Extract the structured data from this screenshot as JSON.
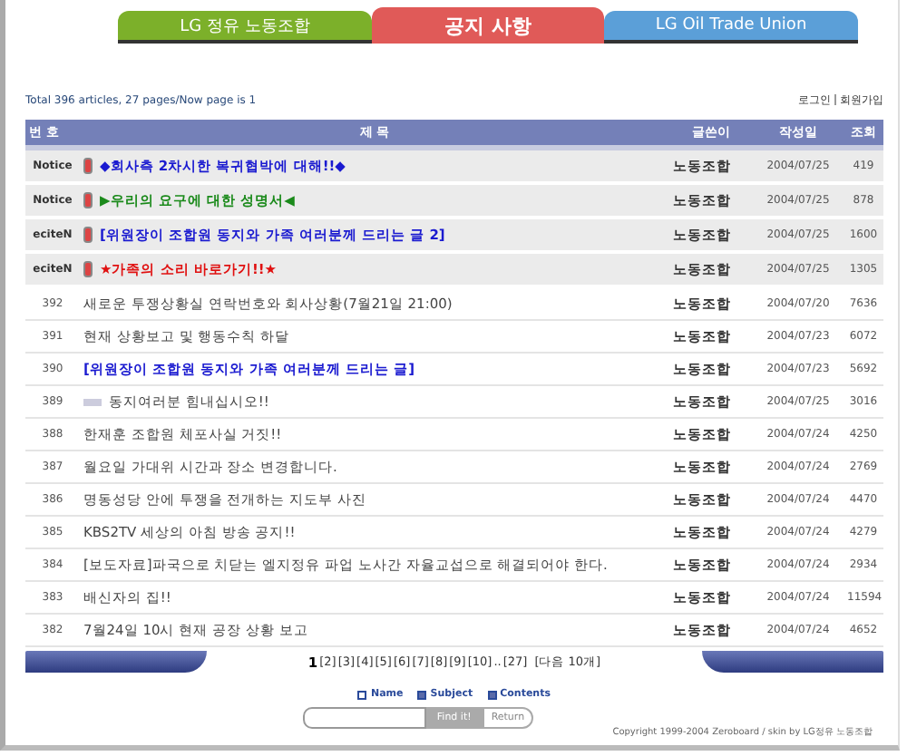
{
  "header_tabs": [
    {
      "label": "LG 정유 노동조합",
      "selected": false
    },
    {
      "label": "공지 사항",
      "selected": true
    },
    {
      "label": "LG Oil Trade Union",
      "selected": false
    }
  ],
  "summary": {
    "total_label": "Total",
    "total": "396",
    "articles_label": "articles,",
    "pages": "27",
    "pages_label": "pages/Now page is",
    "current_page": "1"
  },
  "account_links": [
    "로그인",
    "회원가입"
  ],
  "table": {
    "columns": [
      "번 호",
      "제 목",
      "글쓴이",
      "작성일",
      "조회"
    ],
    "rows": [
      {
        "number": "Notice",
        "notice": true,
        "new": false,
        "title": "◆회사측 2차시한 복귀협박에 대해!!◆",
        "color": "#1a1ad0",
        "emphasis": true,
        "writer": "노동조합",
        "date": "2004/07/25",
        "views": "419"
      },
      {
        "number": "Notice",
        "notice": true,
        "new": false,
        "title": "▶우리의 요구에 대한 성명서◀",
        "color": "#1b8a1b",
        "emphasis": true,
        "writer": "노동조합",
        "date": "2004/07/25",
        "views": "878"
      },
      {
        "number": "eciteN",
        "notice": true,
        "new": false,
        "title": "[위원장이 조합원 동지와 가족 여러분께 드리는 글 2]",
        "color": "#1a1ad0",
        "emphasis": true,
        "writer": "노동조합",
        "date": "2004/07/25",
        "views": "1600"
      },
      {
        "number": "eciteN",
        "notice": true,
        "new": false,
        "title": "★가족의 소리 바로가기!!★",
        "color": "#e01010",
        "emphasis": true,
        "writer": "노동조합",
        "date": "2004/07/25",
        "views": "1305"
      },
      {
        "number": "392",
        "notice": false,
        "new": false,
        "title": "새로운 투쟁상황실 연락번호와 회사상황(7월21일 21:00)",
        "color": "#444444",
        "emphasis": false,
        "writer": "노동조합",
        "date": "2004/07/20",
        "views": "7636"
      },
      {
        "number": "391",
        "notice": false,
        "new": false,
        "title": "현재 상황보고 및 행동수칙 하달",
        "color": "#444444",
        "emphasis": false,
        "writer": "노동조합",
        "date": "2004/07/23",
        "views": "6072"
      },
      {
        "number": "390",
        "notice": false,
        "new": false,
        "title": "[위원장이 조합원 동지와 가족 여러분께 드리는 글]",
        "color": "#1a1ad0",
        "emphasis": true,
        "writer": "노동조합",
        "date": "2004/07/23",
        "views": "5692"
      },
      {
        "number": "389",
        "notice": false,
        "new": true,
        "title": "동지여러분 힘내십시오!!",
        "color": "#444444",
        "emphasis": false,
        "writer": "노동조합",
        "date": "2004/07/25",
        "views": "3016"
      },
      {
        "number": "388",
        "notice": false,
        "new": false,
        "title": "한재훈 조합원 체포사실 거짓!!",
        "color": "#444444",
        "emphasis": false,
        "writer": "노동조합",
        "date": "2004/07/24",
        "views": "4250"
      },
      {
        "number": "387",
        "notice": false,
        "new": false,
        "title": "월요일 가대위 시간과 장소 변경합니다.",
        "color": "#444444",
        "emphasis": false,
        "writer": "노동조합",
        "date": "2004/07/24",
        "views": "2769"
      },
      {
        "number": "386",
        "notice": false,
        "new": false,
        "title": "명동성당 안에 투쟁을 전개하는 지도부 사진",
        "color": "#444444",
        "emphasis": false,
        "writer": "노동조합",
        "date": "2004/07/24",
        "views": "4470"
      },
      {
        "number": "385",
        "notice": false,
        "new": false,
        "title": "KBS2TV 세상의 아침 방송 공지!!",
        "color": "#444444",
        "emphasis": false,
        "writer": "노동조합",
        "date": "2004/07/24",
        "views": "4279"
      },
      {
        "number": "384",
        "notice": false,
        "new": false,
        "title": "[보도자료]파국으로 치닫는 엘지정유 파업 노사간 자율교섭으로 해결되어야 한다.",
        "color": "#444444",
        "emphasis": false,
        "writer": "노동조합",
        "date": "2004/07/24",
        "views": "2934"
      },
      {
        "number": "383",
        "notice": false,
        "new": false,
        "title": "배신자의 집!!",
        "color": "#444444",
        "emphasis": false,
        "writer": "노동조합",
        "date": "2004/07/24",
        "views": "11594"
      },
      {
        "number": "382",
        "notice": false,
        "new": false,
        "title": "7월24일 10시 현재 공장 상황 보고",
        "color": "#444444",
        "emphasis": false,
        "writer": "노동조합",
        "date": "2004/07/24",
        "views": "4652"
      }
    ]
  },
  "pagination": {
    "pages": [
      {
        "label": "1",
        "selected": true
      },
      {
        "label": "[2]",
        "selected": false
      },
      {
        "label": "[3]",
        "selected": false
      },
      {
        "label": "[4]",
        "selected": false
      },
      {
        "label": "[5]",
        "selected": false
      },
      {
        "label": "[6]",
        "selected": false
      },
      {
        "label": "[7]",
        "selected": false
      },
      {
        "label": "[8]",
        "selected": false
      },
      {
        "label": "[9]",
        "selected": false
      },
      {
        "label": "[10]",
        "selected": false
      }
    ],
    "ellipsis": "..",
    "last": "[27]",
    "next": "[다음 10개]"
  },
  "search": {
    "options": [
      {
        "label": "Name",
        "checked": false
      },
      {
        "label": "Subject",
        "checked": true
      },
      {
        "label": "Contents",
        "checked": true
      }
    ],
    "find_button": "Find it!",
    "return_button": "Return"
  },
  "copyright": "Copyright 1999-2004 Zeroboard / skin by LG정유 노동조합"
}
